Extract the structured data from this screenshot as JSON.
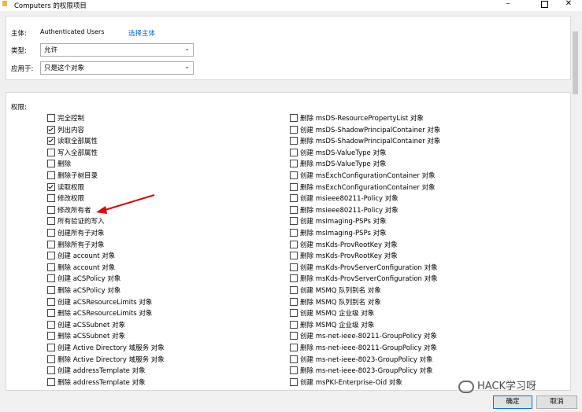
{
  "window": {
    "title": "Computers 的权限项目"
  },
  "principal": {
    "label": "主体:",
    "value": "Authenticated Users",
    "select_link": "选择主体"
  },
  "type": {
    "label": "类型:",
    "value": "允许"
  },
  "applies_to": {
    "label": "应用于:",
    "value": "只是这个对象"
  },
  "permissions_label": "权限:",
  "left_permissions": [
    {
      "label": "完全控制",
      "checked": false
    },
    {
      "label": "列出内容",
      "checked": true
    },
    {
      "label": "读取全部属性",
      "checked": true
    },
    {
      "label": "写入全部属性",
      "checked": false
    },
    {
      "label": "删除",
      "checked": false
    },
    {
      "label": "删除子树目录",
      "checked": false
    },
    {
      "label": "读取权限",
      "checked": true
    },
    {
      "label": "修改权限",
      "checked": false
    },
    {
      "label": "修改所有者",
      "checked": false
    },
    {
      "label": "所有验证的写入",
      "checked": false
    },
    {
      "label": "创建所有子对象",
      "checked": false
    },
    {
      "label": "删除所有子对象",
      "checked": false
    },
    {
      "label": "创建 account 对象",
      "checked": false
    },
    {
      "label": "删除 account 对象",
      "checked": false
    },
    {
      "label": "创建 aCSPolicy 对象",
      "checked": false
    },
    {
      "label": "删除 aCSPolicy 对象",
      "checked": false
    },
    {
      "label": "创建 aCSResourceLimits 对象",
      "checked": false
    },
    {
      "label": "删除 aCSResourceLimits 对象",
      "checked": false
    },
    {
      "label": "创建 aCSSubnet 对象",
      "checked": false
    },
    {
      "label": "删除 aCSSubnet 对象",
      "checked": false
    },
    {
      "label": "创建 Active Directory 域服务 对象",
      "checked": false
    },
    {
      "label": "删除 Active Directory 域服务 对象",
      "checked": false
    },
    {
      "label": "创建 addressTemplate 对象",
      "checked": false
    },
    {
      "label": "删除 addressTemplate 对象",
      "checked": false
    }
  ],
  "right_permissions": [
    {
      "label": "删除 msDS-ResourcePropertyList 对象",
      "checked": false
    },
    {
      "label": "创建 msDS-ShadowPrincipalContainer 对象",
      "checked": false
    },
    {
      "label": "删除 msDS-ShadowPrincipalContainer 对象",
      "checked": false
    },
    {
      "label": "创建 msDS-ValueType 对象",
      "checked": false
    },
    {
      "label": "删除 msDS-ValueType 对象",
      "checked": false
    },
    {
      "label": "创建 msExchConfigurationContainer 对象",
      "checked": false
    },
    {
      "label": "删除 msExchConfigurationContainer 对象",
      "checked": false
    },
    {
      "label": "创建 msieee80211-Policy 对象",
      "checked": false
    },
    {
      "label": "删除 msieee80211-Policy 对象",
      "checked": false
    },
    {
      "label": "创建 msImaging-PSPs 对象",
      "checked": false
    },
    {
      "label": "删除 msImaging-PSPs 对象",
      "checked": false
    },
    {
      "label": "创建 msKds-ProvRootKey 对象",
      "checked": false
    },
    {
      "label": "删除 msKds-ProvRootKey 对象",
      "checked": false
    },
    {
      "label": "创建 msKds-ProvServerConfiguration 对象",
      "checked": false
    },
    {
      "label": "删除 msKds-ProvServerConfiguration 对象",
      "checked": false
    },
    {
      "label": "创建 MSMQ 队列别名 对象",
      "checked": false
    },
    {
      "label": "删除 MSMQ 队列别名 对象",
      "checked": false
    },
    {
      "label": "创建 MSMQ 企业级 对象",
      "checked": false
    },
    {
      "label": "删除 MSMQ 企业级 对象",
      "checked": false
    },
    {
      "label": "创建 ms-net-ieee-80211-GroupPolicy 对象",
      "checked": false
    },
    {
      "label": "删除 ms-net-ieee-80211-GroupPolicy 对象",
      "checked": false
    },
    {
      "label": "创建 ms-net-ieee-8023-GroupPolicy 对象",
      "checked": false
    },
    {
      "label": "删除 ms-net-ieee-8023-GroupPolicy 对象",
      "checked": false
    },
    {
      "label": "创建 msPKI-Enterprise-Oid 对象",
      "checked": false
    }
  ],
  "watermark": "HACK学习呀",
  "buttons": {
    "ok": "确定",
    "cancel": "取消"
  }
}
